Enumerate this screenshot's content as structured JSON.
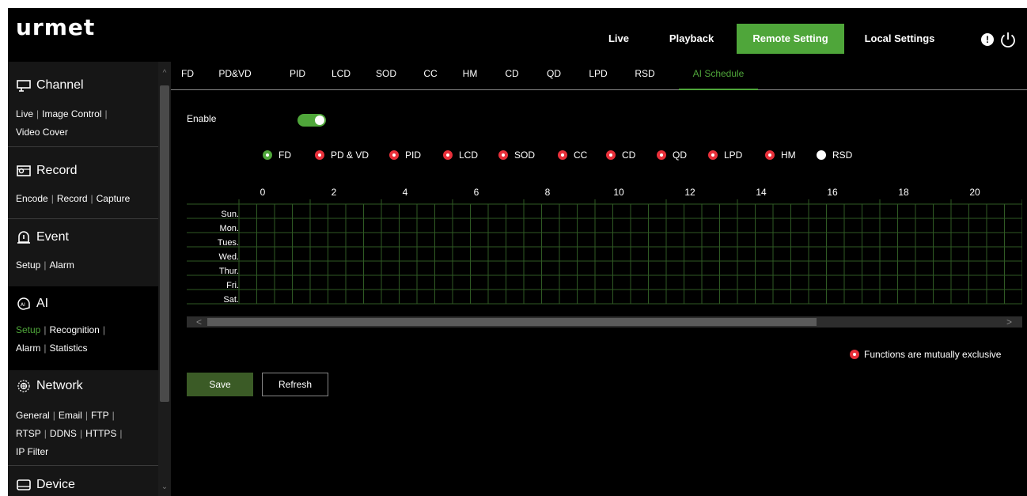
{
  "header": {
    "logo": "urmet",
    "nav": [
      "Live",
      "Playback",
      "Remote Setting",
      "Local Settings"
    ],
    "active_nav": "Remote Setting"
  },
  "sidebar": {
    "sections": [
      {
        "title": "Channel",
        "icon": "monitor-icon",
        "links": [
          [
            "Live",
            "Image Control"
          ],
          [
            "Video Cover"
          ]
        ]
      },
      {
        "title": "Record",
        "icon": "record-icon",
        "links": [
          [
            "Encode",
            "Record",
            "Capture"
          ]
        ]
      },
      {
        "title": "Event",
        "icon": "event-icon",
        "links": [
          [
            "Setup",
            "Alarm"
          ]
        ]
      },
      {
        "title": "AI",
        "icon": "ai-icon",
        "links": [
          [
            "Setup",
            "Recognition"
          ],
          [
            "Alarm",
            "Statistics"
          ]
        ],
        "active_link": "Setup"
      },
      {
        "title": "Network",
        "icon": "network-icon",
        "links": [
          [
            "General",
            "Email",
            "FTP"
          ],
          [
            "RTSP",
            "DDNS",
            "HTTPS"
          ],
          [
            "IP Filter"
          ]
        ]
      },
      {
        "title": "Device",
        "icon": "device-icon",
        "links": []
      }
    ]
  },
  "tabs": [
    "FD",
    "PD&VD",
    "PID",
    "LCD",
    "SOD",
    "CC",
    "HM",
    "CD",
    "QD",
    "LPD",
    "RSD",
    "AI Schedule"
  ],
  "active_tab": "AI Schedule",
  "enable": {
    "label": "Enable",
    "on": true
  },
  "legend": [
    {
      "label": "FD",
      "color": "#4fa63a"
    },
    {
      "label": "PD & VD",
      "color": "#e8303a"
    },
    {
      "label": "PID",
      "color": "#e8303a"
    },
    {
      "label": "LCD",
      "color": "#e8303a"
    },
    {
      "label": "SOD",
      "color": "#e8303a"
    },
    {
      "label": "CC",
      "color": "#e8303a"
    },
    {
      "label": "CD",
      "color": "#e8303a"
    },
    {
      "label": "QD",
      "color": "#e8303a"
    },
    {
      "label": "LPD",
      "color": "#e8303a"
    },
    {
      "label": "HM",
      "color": "#e8303a"
    },
    {
      "label": "RSD",
      "color": "#ffffff"
    }
  ],
  "schedule": {
    "hour_labels": [
      "0",
      "2",
      "4",
      "6",
      "8",
      "10",
      "12",
      "14",
      "16",
      "18",
      "20"
    ],
    "days": [
      "Sun.",
      "Mon.",
      "Tues.",
      "Wed.",
      "Thur.",
      "Fri.",
      "Sat."
    ]
  },
  "mutual_note": "Functions are mutually exclusive",
  "buttons": {
    "save": "Save",
    "refresh": "Refresh"
  },
  "colors": {
    "accent": "#4fa63a",
    "exclusive": "#e8303a",
    "grid": "#2f5a24"
  }
}
